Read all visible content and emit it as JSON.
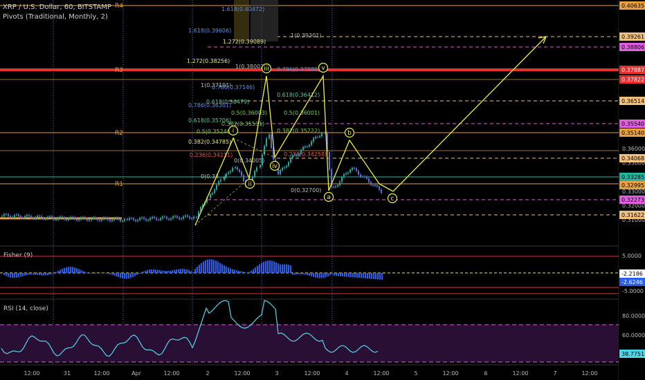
{
  "header": {
    "symbol_line": "XRP / U.S. Dollar, 60, BITSTAMP",
    "indicator_line": "Pivots (Traditional, Monthly, 2)"
  },
  "pivots": [
    {
      "label": "R4",
      "value": 0.40635
    },
    {
      "label": "R3",
      "value": 0.3788
    },
    {
      "label": "R2",
      "value": 0.3515
    },
    {
      "label": "R1",
      "value": 0.3302
    }
  ],
  "fib_labels": [
    {
      "text": "1.618(0.39606)",
      "color": "#5d8fe8"
    },
    {
      "text": "1.272(0.39089)",
      "color": "#e8e880"
    },
    {
      "text": "1.272(0.38256)",
      "color": "#e8e880"
    },
    {
      "text": "1(0.38002)",
      "color": "#bbbbbb"
    },
    {
      "text": "0.786(0.37888)",
      "color": "#5d8fe8"
    },
    {
      "text": "1(0.37191)",
      "color": "#bbbbbb"
    },
    {
      "text": "0.786(0.37146)",
      "color": "#5d8fe8"
    },
    {
      "text": "0.786(0.36301)",
      "color": "#5d8fe8"
    },
    {
      "text": "0.618(0.36479)",
      "color": "#59c9a4"
    },
    {
      "text": "0.618(0.36412)",
      "color": "#59c9a4"
    },
    {
      "text": "0.5(0.36003)",
      "color": "#78c850"
    },
    {
      "text": "0.5(0.36001)",
      "color": "#78c850"
    },
    {
      "text": "0.618(0.35706)",
      "color": "#59c9a4"
    },
    {
      "text": "0.382(0.35531)",
      "color": "#78c850"
    },
    {
      "text": "0.382(0.35222)",
      "color": "#78c850"
    },
    {
      "text": "0.5(0.35246)",
      "color": "#78c850"
    },
    {
      "text": "0.382(0.34785)",
      "color": "#e8e880"
    },
    {
      "text": "0.236(0.34211)",
      "color": "#e85050"
    },
    {
      "text": "0.236(0.34258)",
      "color": "#e85050"
    },
    {
      "text": "0(0.34005)",
      "color": "#bbbbbb"
    },
    {
      "text": "0(0.33...)",
      "color": "#bbbbbb"
    },
    {
      "text": "0(0.32700)",
      "color": "#bbbbbb"
    },
    {
      "text": "1(0.39301)",
      "color": "#bbbbbb"
    },
    {
      "text": "1.618(0.40472)",
      "color": "#5d8fe8"
    }
  ],
  "wave_labels": [
    "i",
    "ii",
    "iii",
    "iv",
    "v",
    "a",
    "b",
    "c"
  ],
  "price_scale": {
    "ticks": [
      "0.37000",
      "0.36000",
      "0.35000",
      "0.34000",
      "0.33000",
      "0.32000",
      "0.31000"
    ],
    "badges": [
      {
        "text": "0.40635",
        "bg": "#e8a040",
        "fg": "#000000"
      },
      {
        "text": "0.39261",
        "bg": "#f0c080",
        "fg": "#000000"
      },
      {
        "text": "0.38806",
        "bg": "#e060e0",
        "fg": "#000000"
      },
      {
        "text": "0.37887",
        "bg": "#e83030",
        "fg": "#ffffff"
      },
      {
        "text": "0.37822",
        "bg": "#e83030",
        "fg": "#ffffff"
      },
      {
        "text": "0.36514",
        "bg": "#f0c080",
        "fg": "#000000"
      },
      {
        "text": "0.35540",
        "bg": "#e060e0",
        "fg": "#000000"
      },
      {
        "text": "0.35140",
        "bg": "#e8a040",
        "fg": "#000000"
      },
      {
        "text": "0.34068",
        "bg": "#f0c080",
        "fg": "#000000"
      },
      {
        "text": "0.33285",
        "bg": "#26b5a0",
        "fg": "#000000"
      },
      {
        "text": "0.32995",
        "bg": "#e8a040",
        "fg": "#000000"
      },
      {
        "text": "0.32273",
        "bg": "#e060e0",
        "fg": "#000000"
      },
      {
        "text": "0.31622",
        "bg": "#f0c080",
        "fg": "#000000"
      }
    ]
  },
  "fisher": {
    "title": "Fisher (9)",
    "ticks": [
      "5.0000",
      "-5.0000"
    ],
    "badges": [
      {
        "text": "-2.2186",
        "bg": "#ffffff",
        "fg": "#000000"
      },
      {
        "text": "-2.6246",
        "bg": "#2a5ef0",
        "fg": "#ffffff"
      }
    ]
  },
  "rsi": {
    "title": "RSI (14, close)",
    "ticks": [
      "80.0000",
      "60.0000"
    ],
    "badges": [
      {
        "text": "38.7751",
        "bg": "#4fd8e8",
        "fg": "#000000"
      }
    ]
  },
  "time_axis": [
    "12:00",
    "31",
    "12:00",
    "Apr",
    "12:00",
    "2",
    "12:00",
    "3",
    "12:00",
    "4",
    "12:00",
    "5",
    "12:00",
    "6",
    "12:00",
    "7",
    "12:00"
  ],
  "colors": {
    "background": "#000000",
    "up_candle": "#26a69a",
    "down_candle": "#5d6dd0",
    "wave_line": "#f0f040",
    "pivot_line": "#e8a040",
    "r3_line": "#e83030",
    "rsi_line": "#4fd8e8",
    "fisher_bar": "#2a5ef0"
  },
  "chart_data": {
    "type": "line",
    "title": "XRP / U.S. Dollar, 60, BITSTAMP",
    "xlabel": "",
    "ylabel": "",
    "ylim": [
      0.305,
      0.408
    ],
    "x": [
      "31 12:00",
      "Apr",
      "Apr 12:00",
      "2",
      "2 12:00",
      "3",
      "3 12:00",
      "4",
      "4 12:00"
    ],
    "series": [
      {
        "name": "XRP / U.S. Dollar, 60, BITSTAMP",
        "values": [
          0.311,
          0.31,
          0.312,
          0.313,
          0.345,
          0.35,
          0.367,
          0.345,
          0.33
        ]
      }
    ],
    "grid": false,
    "legend": "top-left"
  }
}
